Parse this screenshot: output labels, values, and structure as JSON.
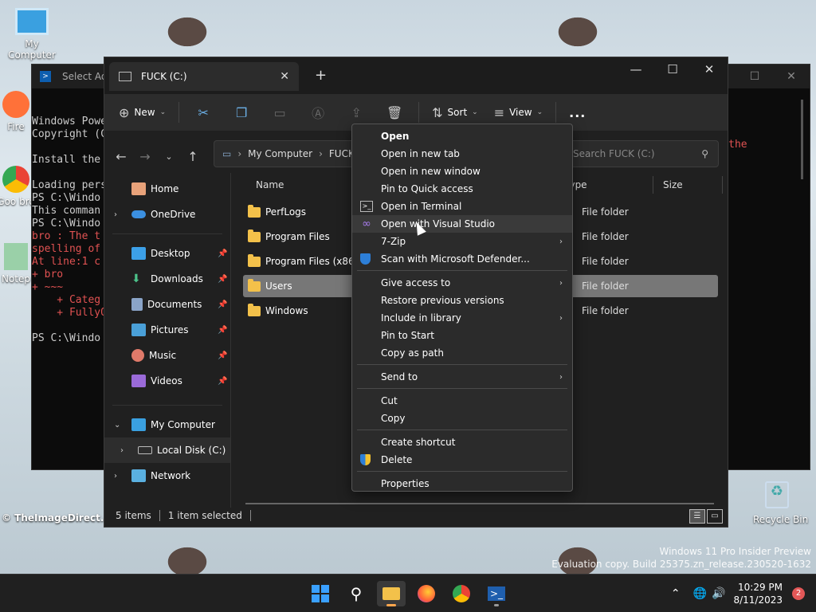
{
  "desktop": {
    "icons": [
      {
        "label": "My Computer"
      },
      {
        "label": "Fire"
      },
      {
        "label": "Goo bro"
      },
      {
        "label": "Notep"
      }
    ],
    "watermark_left": "© TheImageDirect.com",
    "watermark_right": "Recycle Bin",
    "insider_line1": "Windows 11 Pro Insider Preview",
    "insider_line2": "Evaluation copy. Build 25375.zn_release.230520-1632"
  },
  "terminal": {
    "title": "Select Adm",
    "lines": [
      "Windows Powe",
      "Copyright (C",
      "",
      "Install the",
      "",
      "Loading pers",
      "PS C:\\Windo",
      "This comman",
      "PS C:\\Windo"
    ],
    "err_lines": [
      "bro : The t",
      "spelling of",
      "At line:1 c",
      "+ bro",
      "+ ~~~",
      "    + Categ",
      "    + FullyQ"
    ],
    "after_lines": [
      "",
      "PS C:\\Windo"
    ],
    "right_text": "heck the"
  },
  "explorer": {
    "tab_title": "FUCK (C:)",
    "toolbar": {
      "new_label": "New",
      "sort_label": "Sort",
      "view_label": "View",
      "more_label": "..."
    },
    "address": {
      "parts": [
        "My Computer",
        "FUCK"
      ]
    },
    "search_placeholder": "Search FUCK (C:)",
    "sidebar": {
      "home": "Home",
      "onedrive": "OneDrive",
      "quick": [
        "Desktop",
        "Downloads",
        "Documents",
        "Pictures",
        "Music",
        "Videos"
      ],
      "mycomputer": "My Computer",
      "localdisk": "Local Disk (C:)",
      "network": "Network"
    },
    "columns": {
      "name": "Name",
      "type": "Type",
      "size": "Size"
    },
    "files": [
      {
        "name": "PerfLogs",
        "type": "File folder"
      },
      {
        "name": "Program Files",
        "type": "File folder"
      },
      {
        "name": "Program Files (x86)",
        "type": "File folder"
      },
      {
        "name": "Users",
        "type": "File folder"
      },
      {
        "name": "Windows",
        "type": "File folder"
      }
    ],
    "status": {
      "count": "5 items",
      "selected": "1 item selected"
    }
  },
  "context_menu": {
    "group1": [
      "Open",
      "Open in new tab",
      "Open in new window",
      "Pin to Quick access",
      "Open in Terminal",
      "Open with Visual Studio",
      "7-Zip",
      "Scan with Microsoft Defender..."
    ],
    "group2": [
      "Give access to",
      "Restore previous versions",
      "Include in library",
      "Pin to Start",
      "Copy as path"
    ],
    "group3": [
      "Send to"
    ],
    "group4": [
      "Cut",
      "Copy"
    ],
    "group5": [
      "Create shortcut",
      "Delete"
    ],
    "group6": [
      "Properties"
    ]
  },
  "taskbar": {
    "time": "10:29 PM",
    "date": "8/11/2023",
    "notifications": "2"
  }
}
